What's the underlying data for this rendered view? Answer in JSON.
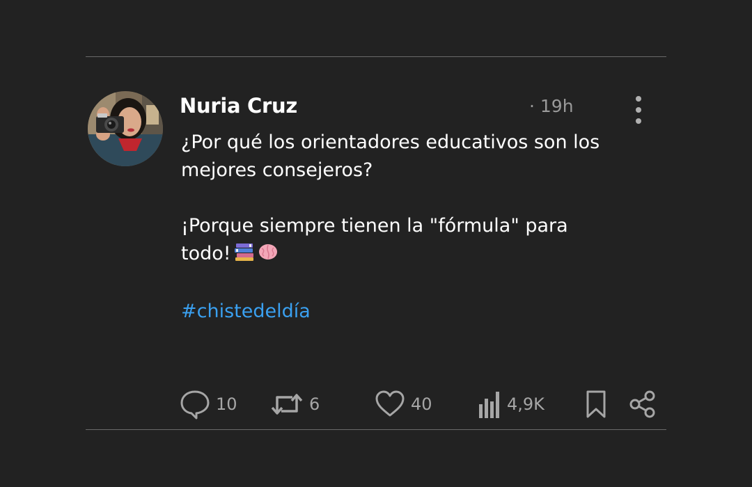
{
  "post": {
    "author": "Nuria Cruz",
    "time": "· 19h",
    "line1": "¿Por qué los orientadores educativos son los",
    "line2": "mejores consejeros?",
    "line3": "¡Porque siempre tienen la \"fórmula\" para",
    "line4": "todo!",
    "emoji_icons": [
      "books-icon",
      "brain-icon"
    ],
    "hashtag": "#chistedeldía"
  },
  "actions": {
    "replies": "10",
    "reposts": "6",
    "likes": "40",
    "views": "4,9K"
  },
  "colors": {
    "background": "#222222",
    "text": "#ffffff",
    "muted": "#a6a6a6",
    "hashtag": "#3aa0f0",
    "divider": "#6a6a6a"
  }
}
